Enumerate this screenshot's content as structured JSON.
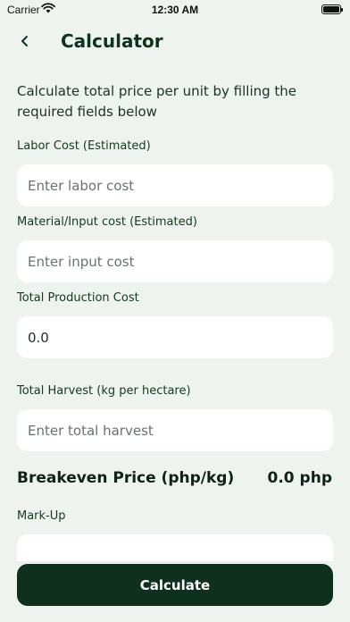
{
  "status_bar": {
    "carrier": "Carrier",
    "time": "12:30 AM"
  },
  "header": {
    "title": "Calculator",
    "back_icon": "chevron-left-icon"
  },
  "description": "Calculate total price per unit by filling the required fields below",
  "fields": {
    "labor": {
      "label": "Labor Cost (Estimated)",
      "placeholder": "Enter labor cost",
      "value": ""
    },
    "material": {
      "label": "Material/Input cost (Estimated)",
      "placeholder": "Enter input cost",
      "value": ""
    },
    "total_production": {
      "label": "Total Production Cost",
      "value": "0.0"
    },
    "total_harvest": {
      "label": "Total Harvest (kg per hectare)",
      "placeholder": "Enter total harvest",
      "value": ""
    },
    "markup": {
      "label": "Mark-Up",
      "value": ""
    }
  },
  "breakeven": {
    "label": "Breakeven Price (php/kg)",
    "value": "0.0 php"
  },
  "actions": {
    "calculate_label": "Calculate"
  },
  "colors": {
    "background": "#eef3ef",
    "primary": "#0f2f1f",
    "field_bg": "#ffffff"
  }
}
